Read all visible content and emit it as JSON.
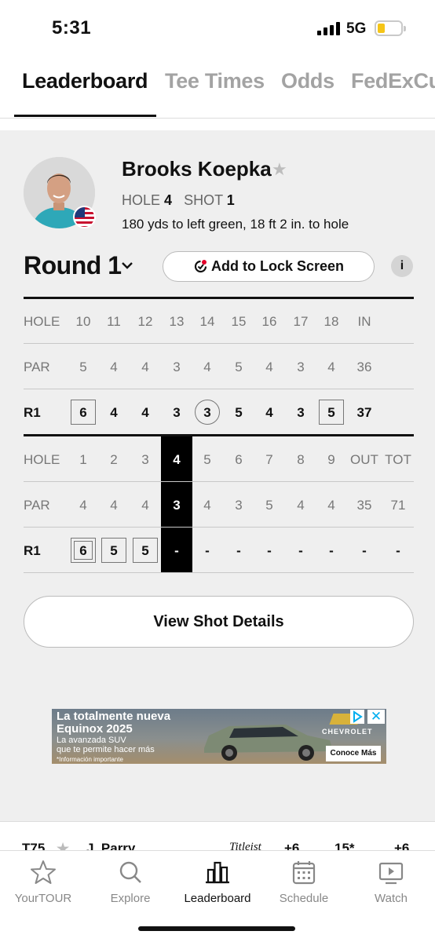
{
  "status_bar": {
    "time": "5:31",
    "network": "5G"
  },
  "tabs": [
    {
      "label": "Leaderboard",
      "active": true
    },
    {
      "label": "Tee Times",
      "active": false
    },
    {
      "label": "Odds",
      "active": false
    },
    {
      "label": "FedExCup",
      "active": false
    }
  ],
  "player": {
    "name": "Brooks Koepka",
    "hole_label": "HOLE",
    "hole": "4",
    "shot_label": "SHOT",
    "shot": "1",
    "location": "180 yds to left green, 18 ft 2 in. to hole"
  },
  "round": {
    "title": "Round 1",
    "lock_button": "Add to Lock Screen",
    "info": "i"
  },
  "back_nine": {
    "hole_label": "HOLE",
    "holes": [
      "10",
      "11",
      "12",
      "13",
      "14",
      "15",
      "16",
      "17",
      "18"
    ],
    "total_label": "IN",
    "par_label": "PAR",
    "par": [
      "5",
      "4",
      "4",
      "3",
      "4",
      "5",
      "4",
      "3",
      "4"
    ],
    "par_total": "36",
    "score_label": "R1",
    "scores": [
      "6",
      "4",
      "4",
      "3",
      "3",
      "5",
      "4",
      "3",
      "5"
    ],
    "score_total": "37"
  },
  "front_nine": {
    "hole_label": "HOLE",
    "holes": [
      "1",
      "2",
      "3",
      "4",
      "5",
      "6",
      "7",
      "8",
      "9"
    ],
    "out_label": "OUT",
    "tot_label": "TOT",
    "par_label": "PAR",
    "par": [
      "4",
      "4",
      "4",
      "3",
      "4",
      "3",
      "5",
      "4",
      "4"
    ],
    "par_out": "35",
    "par_tot": "71",
    "score_label": "R1",
    "scores": [
      "6",
      "5",
      "5",
      "-",
      "-",
      "-",
      "-",
      "-",
      "-"
    ],
    "score_out": "-",
    "score_tot": "-",
    "current_hole": "4"
  },
  "shot_details_button": "View Shot Details",
  "ad": {
    "headline_1": "La totalmente nueva",
    "headline_2": "Equinox 2025",
    "body_1": "La avanzada SUV",
    "body_2": "que te permite hacer más",
    "note": "*Información importante",
    "brand": "CHEVROLET",
    "cta": "Conoce Más"
  },
  "next_row": {
    "pos": "T75",
    "name": "J. Parry",
    "score": "+6",
    "thru": "15*",
    "total": "+6"
  },
  "bottom_nav": [
    {
      "label": "YourTOUR",
      "icon": "star-icon",
      "active": false
    },
    {
      "label": "Explore",
      "icon": "search-icon",
      "active": false
    },
    {
      "label": "Leaderboard",
      "icon": "leaderboard-icon",
      "active": true
    },
    {
      "label": "Schedule",
      "icon": "calendar-icon",
      "active": false
    },
    {
      "label": "Watch",
      "icon": "play-icon",
      "active": false
    }
  ],
  "colors": {
    "accent": "#111111",
    "muted": "#a3a3a3",
    "panel": "#efefef",
    "battery": "#f5c518"
  }
}
